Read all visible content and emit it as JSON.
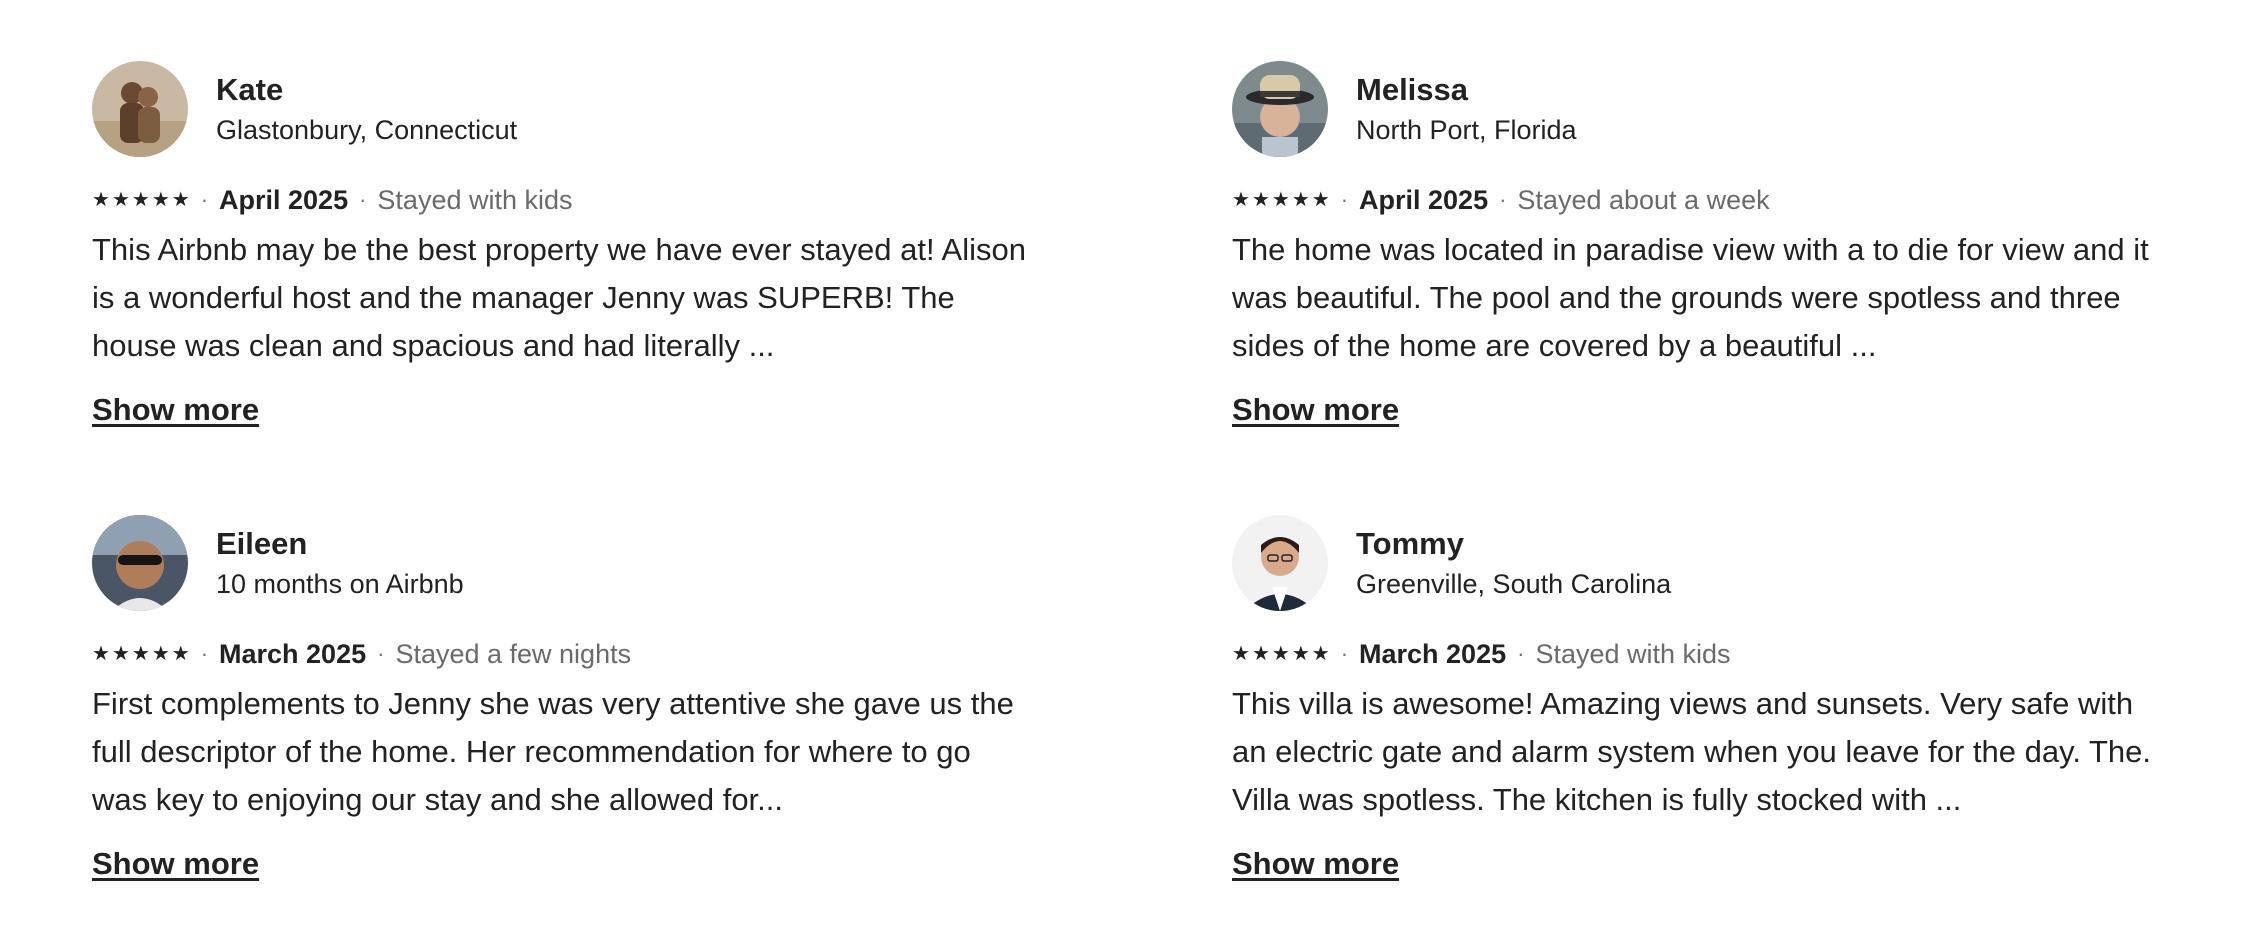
{
  "reviews": [
    {
      "name": "Kate",
      "subtitle": "Glastonbury, Connecticut",
      "rating": 5,
      "date": "April 2025",
      "stay": "Stayed with kids",
      "text": "This Airbnb may be the best property we have ever stayed at! Alison is a wonderful host and the manager Jenny was SUPERB! The house was clean and spacious and had literally ...",
      "show_more": "Show more"
    },
    {
      "name": "Melissa",
      "subtitle": "North Port, Florida",
      "rating": 5,
      "date": "April 2025",
      "stay": "Stayed about a week",
      "text": "The home was located in paradise view with a to die for view and it was beautiful. The pool and the grounds were spotless and three sides of the home are covered by a beautiful ...",
      "show_more": "Show more"
    },
    {
      "name": "Eileen",
      "subtitle": "10 months on Airbnb",
      "rating": 5,
      "date": "March 2025",
      "stay": "Stayed a few nights",
      "text": "First complements to Jenny she was very attentive she gave us the full descriptor of the home. Her recommendation for where to go was key to enjoying our stay and she allowed for...",
      "show_more": "Show more"
    },
    {
      "name": "Tommy",
      "subtitle": "Greenville, South Carolina",
      "rating": 5,
      "date": "March 2025",
      "stay": "Stayed with kids",
      "text": "This villa is awesome! Amazing views and sunsets. Very safe with an electric gate and alarm system when you leave for the day. The. Villa was spotless. The kitchen is fully stocked with ...",
      "show_more": "Show more"
    }
  ],
  "separator": "·",
  "star_glyph": "★",
  "colors": {
    "text": "#222222",
    "muted": "#6a6a6a"
  }
}
